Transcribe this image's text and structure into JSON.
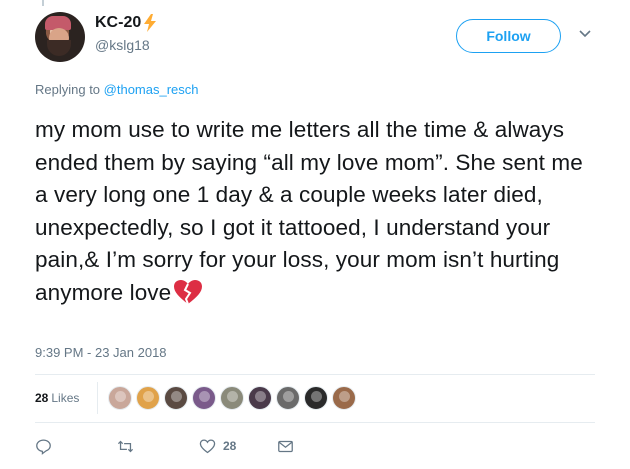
{
  "user": {
    "display_name": "KC-20",
    "handle": "@kslg18",
    "name_emoji": "lightning-bolt"
  },
  "follow_button": {
    "label": "Follow"
  },
  "reply": {
    "prefix": "Replying to ",
    "mention": "@thomas_resch"
  },
  "tweet": {
    "text": "my mom use to write me letters all the time & always ended them by saying “all my love mom”. She sent me a very long one 1 day & a couple weeks later died, unexpectedly, so I got it tattooed, I understand your pain,& I’m sorry for your loss, your mom isn’t hurting anymore love",
    "trailing_emoji": "broken-heart",
    "timestamp": "9:39 PM - 23 Jan 2018"
  },
  "stats": {
    "likes_count": "28",
    "likes_label": "Likes",
    "liker_colors": [
      "#c9a79a",
      "#e0a24a",
      "#5a4a42",
      "#7a5a8a",
      "#8a8a7a",
      "#4a3a4a",
      "#6a6a6a",
      "#2a2a2a",
      "#9a6a4a"
    ]
  },
  "actions": {
    "like_count": "28",
    "colors": {
      "icon": "#657786",
      "accent": "#1da1f2"
    }
  }
}
